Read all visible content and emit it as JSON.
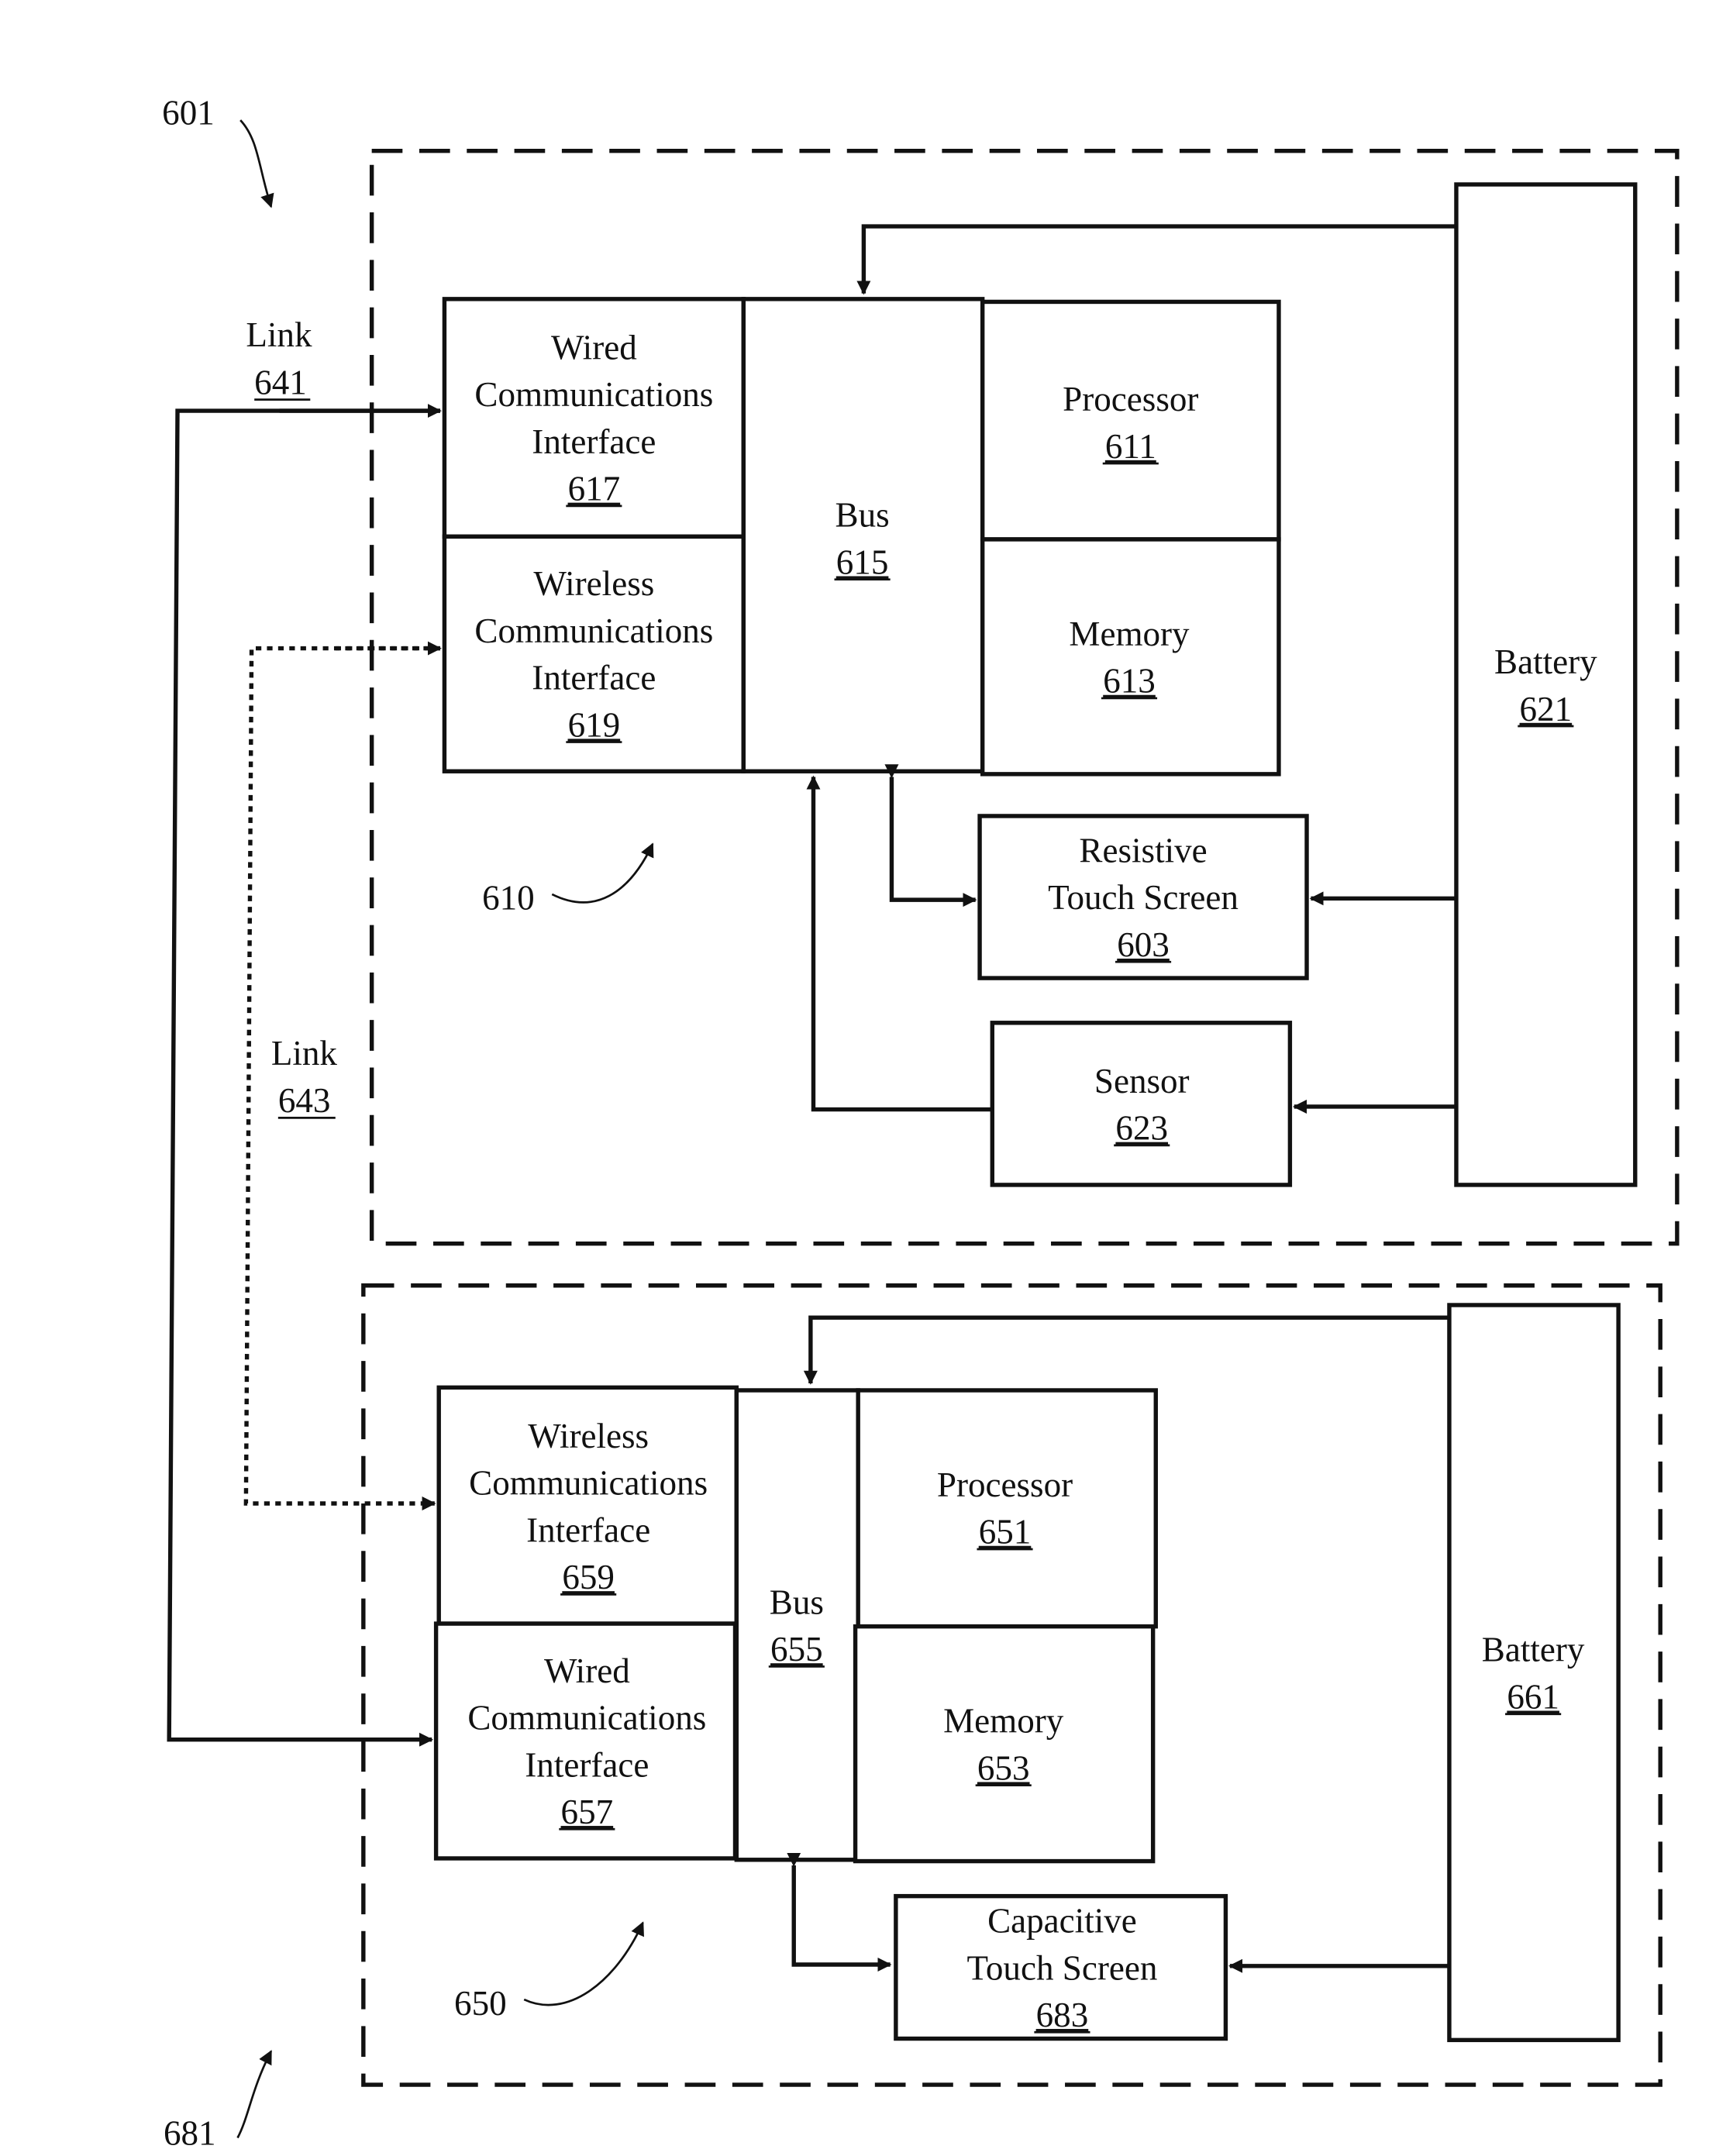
{
  "figure": {
    "ref_main": "601",
    "ref_bottom": "681",
    "device_top": {
      "ref": "610",
      "wired_if": {
        "lines": [
          "Wired",
          "Communications",
          "Interface"
        ],
        "num": "617"
      },
      "wireless_if": {
        "lines": [
          "Wireless",
          "Communications",
          "Interface"
        ],
        "num": "619"
      },
      "bus": {
        "lines": [
          "Bus"
        ],
        "num": "615"
      },
      "processor": {
        "lines": [
          "Processor"
        ],
        "num": "611"
      },
      "memory": {
        "lines": [
          "Memory"
        ],
        "num": "613"
      },
      "battery": {
        "lines": [
          "Battery"
        ],
        "num": "621"
      },
      "touch": {
        "lines": [
          "Resistive",
          "Touch Screen"
        ],
        "num": "603"
      },
      "sensor": {
        "lines": [
          "Sensor"
        ],
        "num": "623"
      }
    },
    "device_bottom": {
      "ref": "650",
      "wireless_if": {
        "lines": [
          "Wireless",
          "Communications",
          "Interface"
        ],
        "num": "659"
      },
      "wired_if": {
        "lines": [
          "Wired",
          "Communications",
          "Interface"
        ],
        "num": "657"
      },
      "bus": {
        "lines": [
          "Bus"
        ],
        "num": "655"
      },
      "processor": {
        "lines": [
          "Processor"
        ],
        "num": "651"
      },
      "memory": {
        "lines": [
          "Memory"
        ],
        "num": "653"
      },
      "battery": {
        "lines": [
          "Battery"
        ],
        "num": "661"
      },
      "touch": {
        "lines": [
          "Capacitive",
          "Touch Screen"
        ],
        "num": "683"
      }
    },
    "links": {
      "wired": {
        "label": "Link",
        "num": "641"
      },
      "wireless": {
        "label": "Link",
        "num": "643"
      }
    }
  }
}
